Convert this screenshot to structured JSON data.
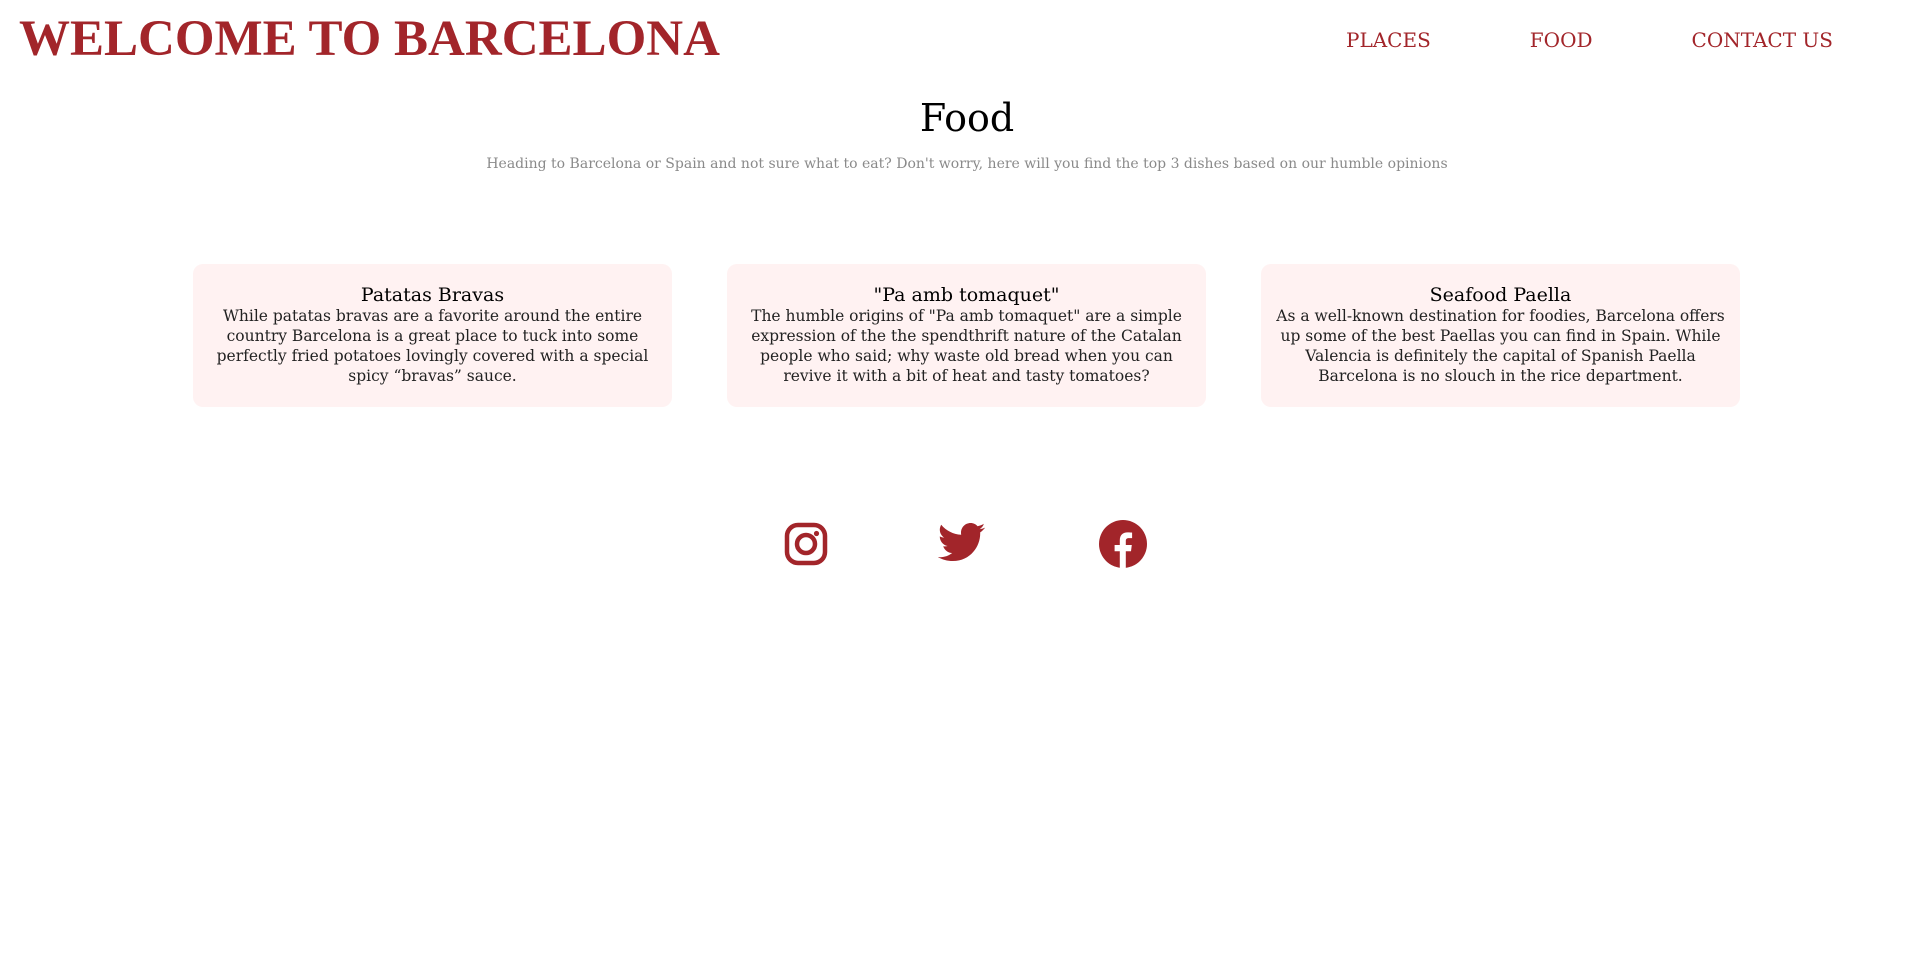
{
  "header": {
    "site_title": "WELCOME TO BARCELONA",
    "nav": [
      {
        "label": "PLACES"
      },
      {
        "label": "FOOD"
      },
      {
        "label": "CONTACT US"
      }
    ]
  },
  "main": {
    "heading": "Food",
    "subtitle": "Heading to Barcelona or Spain and not sure what to eat? Don't worry, here will you find the top 3 dishes based on our humble opinions",
    "cards": [
      {
        "title": "Patatas Bravas",
        "text": "While patatas bravas are a favorite around the entire country Barcelona is a great place to tuck into some perfectly fried potatoes lovingly covered with a special spicy “bravas” sauce."
      },
      {
        "title": "\"Pa amb tomaquet\"",
        "text": "The humble origins of \"Pa amb tomaquet\" are a simple expression of the the spendthrift nature of the Catalan people who said; why waste old bread when you can revive it with a bit of heat and tasty tomatoes?"
      },
      {
        "title": "Seafood Paella",
        "text": "As a well-known destination for foodies, Barcelona offers up some of the best Paellas you can find in Spain. While Valencia is definitely the capital of Spanish Paella Barcelona is no slouch in the rice department."
      }
    ]
  },
  "footer": {
    "socials": [
      {
        "icon": "instagram-icon"
      },
      {
        "icon": "twitter-icon"
      },
      {
        "icon": "facebook-icon"
      }
    ]
  },
  "colors": {
    "accent": "#a2252a",
    "card_background": "#fff2f2",
    "subtitle": "#8a8a8a"
  }
}
